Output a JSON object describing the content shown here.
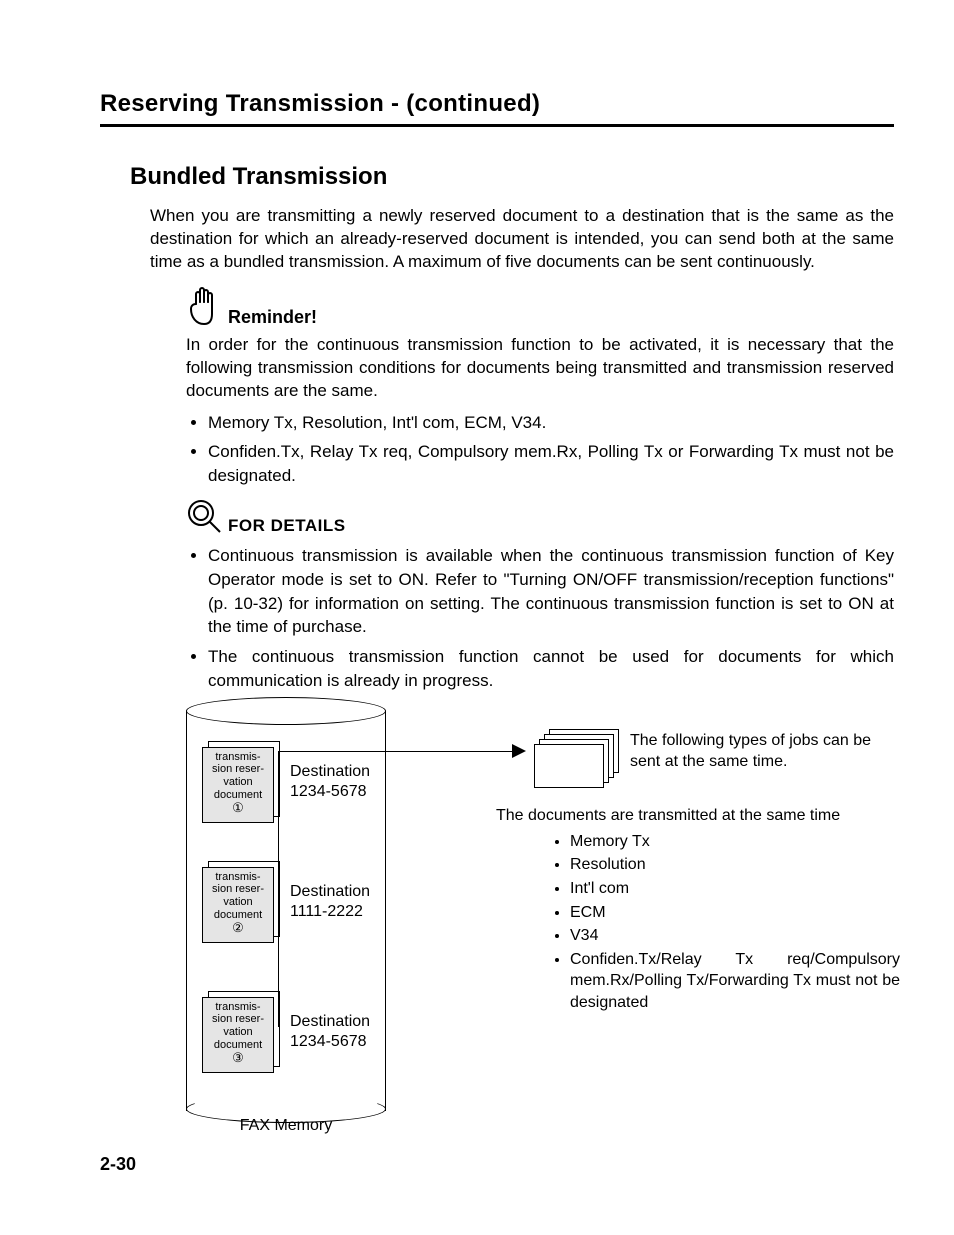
{
  "running_head": "Reserving Transmission -  (continued)",
  "section_title": "Bundled Transmission",
  "intro": "When you are transmitting a newly reserved document to a destination that is the same as the destination for which an already-reserved document is intended, you can send both at the same time as a bundled transmission. A maximum of five documents can be sent continuously.",
  "reminder": {
    "label": "Reminder!",
    "body": "In order for the continuous transmission function to be activated, it is necessary that the following transmission conditions for documents being transmitted and transmission reserved documents are the same.",
    "bullets": [
      "Memory Tx, Resolution, Int'l com, ECM, V34.",
      "Confiden.Tx, Relay Tx req, Compulsory mem.Rx, Polling Tx or Forwarding Tx must not be designated."
    ]
  },
  "details": {
    "label": "FOR DETAILS",
    "bullets": [
      "Continuous transmission is available when the continuous transmission function of Key Operator mode is set to ON. Refer to \"Turning ON/OFF transmission/reception functions\" (p. 10-32) for information on setting. The continuous transmission function is set to ON at the time of purchase.",
      "The continuous transmission function cannot be used for documents for which communication is already in progress."
    ]
  },
  "diagram": {
    "fax_memory_label": "FAX Memory",
    "doc_label_lines": [
      "transmis-",
      "sion reser-",
      "vation",
      "document"
    ],
    "circled": [
      "①",
      "②",
      "③"
    ],
    "dest_label": "Destination",
    "destinations": [
      "1234-5678",
      "1111-2222",
      "1234-5678"
    ],
    "right_caption": "The following types of jobs can be sent at the same time.",
    "mid_caption": "The documents are transmitted at the same time",
    "conditions": [
      "Memory Tx",
      "Resolution",
      "Int'l com",
      "ECM",
      "V34",
      "Confiden.Tx/Relay Tx req/Compulsory mem.Rx/Polling Tx/Forwarding Tx must not be designated"
    ]
  },
  "page_number": "2-30"
}
